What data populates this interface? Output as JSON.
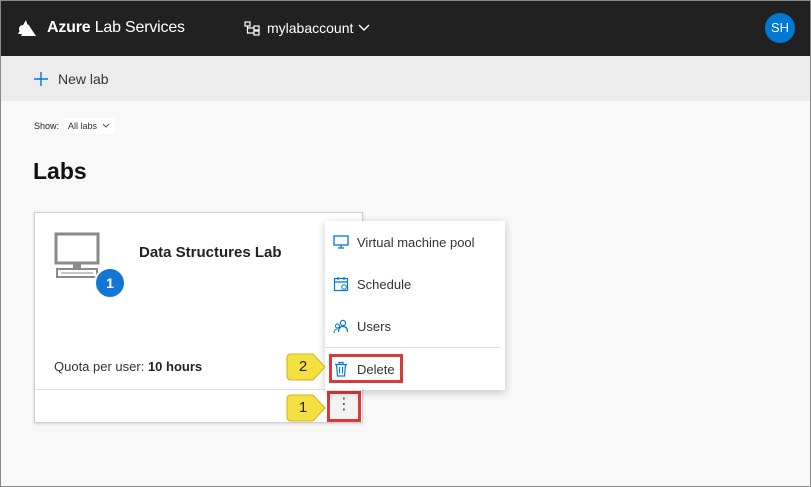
{
  "header": {
    "brand_bold": "Azure",
    "brand_rest": "Lab Services",
    "account": "mylabaccount",
    "avatar_initials": "SH"
  },
  "toolbar": {
    "new_lab_label": "New lab"
  },
  "filter": {
    "show_label": "Show:",
    "show_value": "All labs"
  },
  "page": {
    "title": "Labs"
  },
  "lab_card": {
    "name": "Data Structures Lab",
    "vm_count": "1",
    "quota_label": "Quota per user:",
    "quota_value": "10 hours",
    "more_glyph": "⋮"
  },
  "context_menu": {
    "items": [
      {
        "label": "Virtual machine pool",
        "icon": "monitor-icon"
      },
      {
        "label": "Schedule",
        "icon": "calendar-icon"
      },
      {
        "label": "Users",
        "icon": "users-icon"
      },
      {
        "label": "Delete",
        "icon": "trash-icon"
      }
    ]
  },
  "callouts": {
    "step_1": "1",
    "step_2": "2"
  },
  "colors": {
    "accent": "#0078d4",
    "highlight": "#d93a3a",
    "callout": "#f5e042",
    "topbar": "#212121"
  }
}
